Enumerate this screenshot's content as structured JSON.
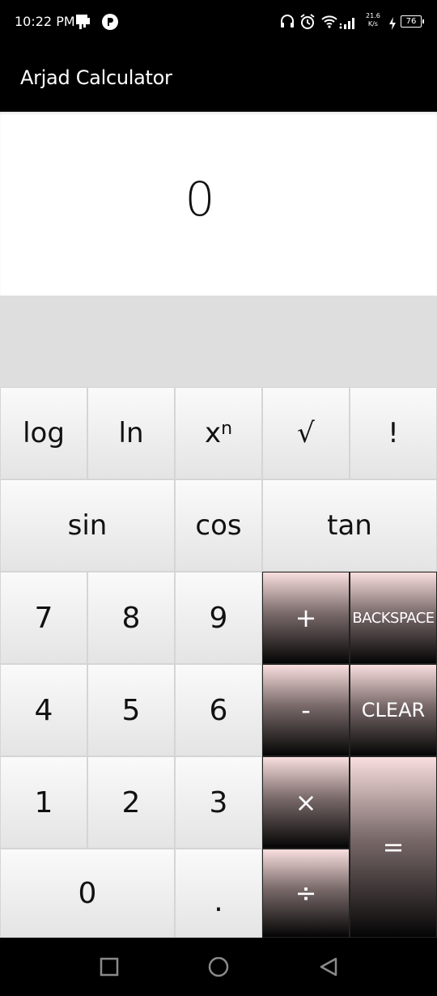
{
  "status_bar": {
    "time": "10:22 PM",
    "net_speed_value": "21.6",
    "net_speed_unit": "K/s",
    "battery": "76",
    "icons": [
      "sim-icon",
      "app-notification-icon",
      "headset-icon",
      "alarm-icon",
      "wifi-icon",
      "signal-icon",
      "charging-icon",
      "battery-icon"
    ]
  },
  "app": {
    "title": "Arjad Calculator"
  },
  "display": {
    "value": "0"
  },
  "keys": {
    "log": "log",
    "ln": "ln",
    "power_base": "x",
    "power_exp": "n",
    "sqrt": "√",
    "factorial": "!",
    "sin": "sin",
    "cos": "cos",
    "tan": "tan",
    "seven": "7",
    "eight": "8",
    "nine": "9",
    "plus": "+",
    "backspace": "BACKSPACE",
    "four": "4",
    "five": "5",
    "six": "6",
    "minus": "-",
    "clear": "CLEAR",
    "one": "1",
    "two": "2",
    "three": "3",
    "multiply": "×",
    "equals": "=",
    "zero": "0",
    "dot": ".",
    "divide": "÷"
  },
  "nav_bar": {
    "icons": [
      "recents-square-icon",
      "home-circle-icon",
      "back-triangle-icon"
    ]
  }
}
